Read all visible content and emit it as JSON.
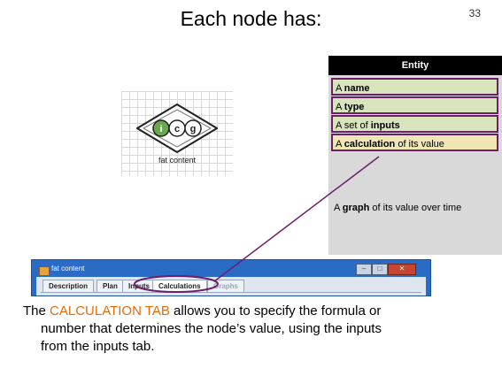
{
  "slide": {
    "title": "Each node has:",
    "page_number": "33"
  },
  "node": {
    "icons": [
      "i",
      "c",
      "g"
    ],
    "label": "fat content"
  },
  "entity_table": {
    "header": "Entity",
    "rows": [
      {
        "prefix": "A ",
        "bold": "name",
        "suffix": ""
      },
      {
        "prefix": "A ",
        "bold": "type",
        "suffix": ""
      },
      {
        "prefix": "A set of ",
        "bold": "inputs",
        "suffix": ""
      },
      {
        "prefix": "A ",
        "bold": "calculation",
        "suffix": " of its value"
      }
    ],
    "graph_row": {
      "prefix": "A ",
      "bold": "graph",
      "suffix": " of its value over time"
    }
  },
  "window": {
    "title": "fat content",
    "tabs": [
      "Description",
      "Plan",
      "Inputs",
      "Calculations",
      "Graphs"
    ],
    "active_tab": "Calculations"
  },
  "caption": {
    "before": "The ",
    "highlight": "CALCULATION TAB",
    "line1_after": " allows you to specify the formula or",
    "line2": "number that determines the node’s value, using the inputs",
    "line3": "from the inputs tab."
  },
  "colors": {
    "highlight": "#e46c0a",
    "annotation": "#6a1f6a",
    "window_blue": "#2a6bc6"
  }
}
